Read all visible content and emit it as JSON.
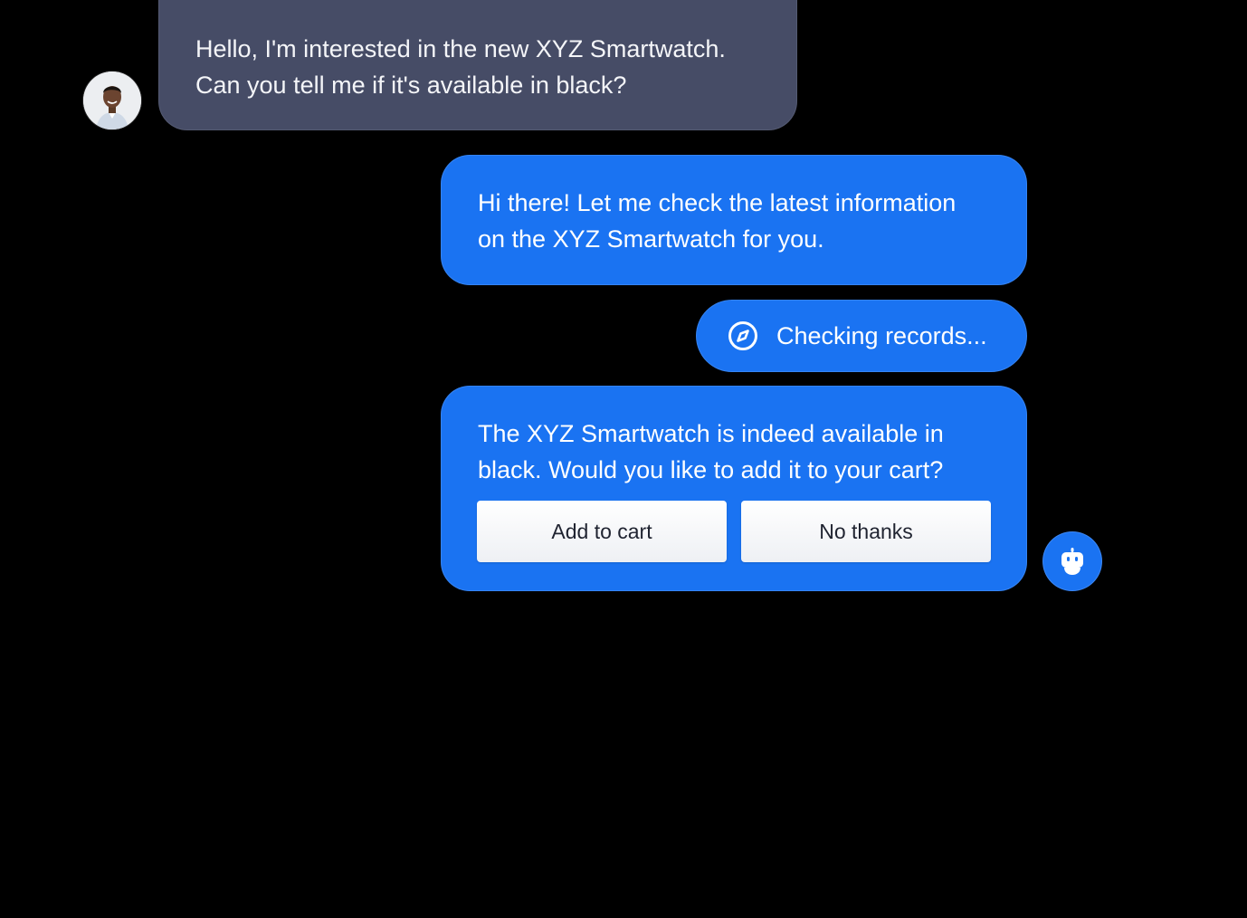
{
  "user_message": {
    "lines": [
      "Hello, I'm interested in the new XYZ Smartwatch.",
      "Can you tell me if it's available in black?"
    ],
    "avatar_icon": "user-avatar-photo"
  },
  "bot_messages": [
    {
      "lines": [
        "Hi there! Let me check the latest information",
        "on the XYZ Smartwatch for you."
      ]
    },
    {
      "lines": [
        "The XYZ Smartwatch is indeed available in",
        "black. Would you like to add it to your cart?"
      ],
      "actions": [
        {
          "label": "Add to cart"
        },
        {
          "label": "No thanks"
        }
      ]
    }
  ],
  "status": {
    "label": "Checking records...",
    "icon": "compass-icon"
  },
  "bot_avatar": {
    "icon": "robot-icon"
  },
  "colors": {
    "background": "#000000",
    "user_bubble": "#464c66",
    "bot_bubble": "#1a73f2",
    "button_bg": "#ffffff",
    "button_text": "#1f2330"
  }
}
